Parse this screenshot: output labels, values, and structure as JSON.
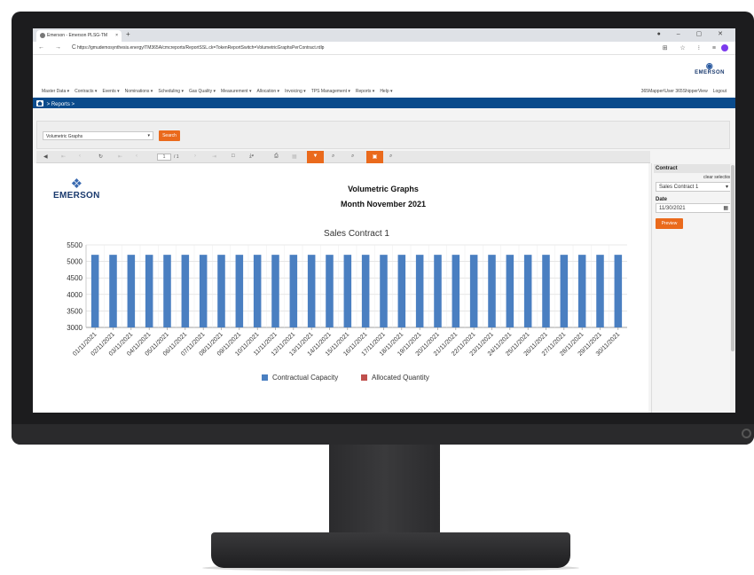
{
  "browser": {
    "tab_title": "Emerson - Emerson PLSG-TM",
    "tab_close": "×",
    "new_tab": "+",
    "window_controls": "● – ▢ ✕",
    "nav_buttons": "← → C",
    "url": "https://gmudemosynthesis.energy/TM365A/cmcreports/ReportSSL.ck=TokenReportSwitch=VolumetricGraphsPerContract.rdlp",
    "right_icons": "⊞ ☆ ⁝ ≡"
  },
  "app": {
    "logo_text": "EMERSON",
    "menu": [
      "Master Data ▾",
      "Contracts ▾",
      "Events ▾",
      "Nominations ▾",
      "Scheduling ▾",
      "Gas Quality ▾",
      "Measurement ▾",
      "Allocation ▾",
      "Invoicing ▾",
      "TPS Management ▾",
      "Reports ▾",
      "Help ▾"
    ],
    "user_info": [
      "365Mapper\\User 365ShipperView",
      "Logout"
    ],
    "breadcrumb": "> Reports >"
  },
  "filter": {
    "selected_report": "Volumetric Graphs",
    "search_label": "Search"
  },
  "toolbar": {
    "page_current": "1",
    "page_total": "/ 1"
  },
  "report": {
    "logo_text": "EMERSON",
    "title": "Volumetric Graphs",
    "subtitle": "Month November 2021"
  },
  "sidebar": {
    "contract_label": "Contract",
    "clear_selection": "clear selection",
    "contract_value": "Sales Contract 1",
    "date_label": "Date",
    "date_value": "11/30/2021",
    "preview_label": "Preview"
  },
  "colors": {
    "accent": "#ea6a1c",
    "nav_blue": "#0a4b8c",
    "series1": "#4a7fc1",
    "series2": "#c0504d"
  },
  "chart_data": {
    "type": "bar",
    "title": "Sales Contract 1",
    "xlabel": "",
    "ylabel": "",
    "ylim": [
      3000,
      5500
    ],
    "yticks": [
      3000,
      3500,
      4000,
      4500,
      5000,
      5500
    ],
    "grid": true,
    "legend_placement": "bottom",
    "categories": [
      "01/11/2021",
      "02/11/2021",
      "03/11/2021",
      "04/11/2021",
      "05/11/2021",
      "06/11/2021",
      "07/11/2021",
      "08/11/2021",
      "09/11/2021",
      "10/11/2021",
      "11/11/2021",
      "12/11/2021",
      "13/11/2021",
      "14/11/2021",
      "15/11/2021",
      "16/11/2021",
      "17/11/2021",
      "18/11/2021",
      "19/11/2021",
      "20/11/2021",
      "21/11/2021",
      "22/11/2021",
      "23/11/2021",
      "24/11/2021",
      "25/11/2021",
      "26/11/2021",
      "27/11/2021",
      "28/11/2021",
      "29/11/2021",
      "30/11/2021"
    ],
    "series": [
      {
        "name": "Contractual Capacity",
        "color": "#4a7fc1",
        "values": [
          5200,
          5200,
          5200,
          5200,
          5200,
          5200,
          5200,
          5200,
          5200,
          5200,
          5200,
          5200,
          5200,
          5200,
          5200,
          5200,
          5200,
          5200,
          5200,
          5200,
          5200,
          5200,
          5200,
          5200,
          5200,
          5200,
          5200,
          5200,
          5200,
          5200
        ]
      },
      {
        "name": "Allocated Quantity",
        "color": "#c0504d",
        "values": []
      }
    ]
  }
}
